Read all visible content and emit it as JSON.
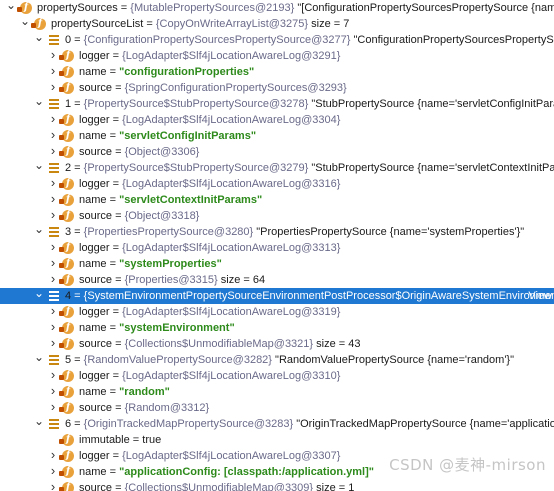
{
  "rows": [
    {
      "indent": 0,
      "toggle": "down",
      "icon": "field",
      "name": "propertySources",
      "eq": " = ",
      "val": "{MutablePropertySources@2193}",
      "extra": " \"[ConfigurationPropertySourcesPropertySource {name='c..."
    },
    {
      "indent": 1,
      "toggle": "down",
      "icon": "field",
      "name": "propertySourceList",
      "eq": " = ",
      "val": "{CopyOnWriteArrayList@3275}",
      "extra": "  size = 7"
    },
    {
      "indent": 2,
      "toggle": "down",
      "icon": "list",
      "name": "0",
      "eq": " = ",
      "val": "{ConfigurationPropertySourcesPropertySource@3277}",
      "extra": " \"ConfigurationPropertySourcesPropertySource {nam"
    },
    {
      "indent": 3,
      "toggle": "right",
      "icon": "field",
      "name": "logger",
      "eq": " = ",
      "val": "{LogAdapter$Slf4jLocationAwareLog@3291}",
      "extra": ""
    },
    {
      "indent": 3,
      "toggle": "right",
      "icon": "field",
      "name": "name",
      "eq": " = ",
      "str": "\"configurationProperties\"",
      "extra": ""
    },
    {
      "indent": 3,
      "toggle": "right",
      "icon": "field",
      "name": "source",
      "eq": " = ",
      "val": "{SpringConfigurationPropertySources@3293}",
      "extra": ""
    },
    {
      "indent": 2,
      "toggle": "down",
      "icon": "list",
      "name": "1",
      "eq": " = ",
      "val": "{PropertySource$StubPropertySource@3278}",
      "extra": " \"StubPropertySource {name='servletConfigInitParams'}\""
    },
    {
      "indent": 3,
      "toggle": "right",
      "icon": "field",
      "name": "logger",
      "eq": " = ",
      "val": "{LogAdapter$Slf4jLocationAwareLog@3304}",
      "extra": ""
    },
    {
      "indent": 3,
      "toggle": "right",
      "icon": "field",
      "name": "name",
      "eq": " = ",
      "str": "\"servletConfigInitParams\"",
      "extra": ""
    },
    {
      "indent": 3,
      "toggle": "right",
      "icon": "field",
      "name": "source",
      "eq": " = ",
      "val": "{Object@3306}",
      "extra": ""
    },
    {
      "indent": 2,
      "toggle": "down",
      "icon": "list",
      "name": "2",
      "eq": " = ",
      "val": "{PropertySource$StubPropertySource@3279}",
      "extra": " \"StubPropertySource {name='servletContextInitParams'}\""
    },
    {
      "indent": 3,
      "toggle": "right",
      "icon": "field",
      "name": "logger",
      "eq": " = ",
      "val": "{LogAdapter$Slf4jLocationAwareLog@3316}",
      "extra": ""
    },
    {
      "indent": 3,
      "toggle": "right",
      "icon": "field",
      "name": "name",
      "eq": " = ",
      "str": "\"servletContextInitParams\"",
      "extra": ""
    },
    {
      "indent": 3,
      "toggle": "right",
      "icon": "field",
      "name": "source",
      "eq": " = ",
      "val": "{Object@3318}",
      "extra": ""
    },
    {
      "indent": 2,
      "toggle": "down",
      "icon": "list",
      "name": "3",
      "eq": " = ",
      "val": "{PropertiesPropertySource@3280}",
      "extra": " \"PropertiesPropertySource {name='systemProperties'}\""
    },
    {
      "indent": 3,
      "toggle": "right",
      "icon": "field",
      "name": "logger",
      "eq": " = ",
      "val": "{LogAdapter$Slf4jLocationAwareLog@3313}",
      "extra": ""
    },
    {
      "indent": 3,
      "toggle": "right",
      "icon": "field",
      "name": "name",
      "eq": " = ",
      "str": "\"systemProperties\"",
      "extra": ""
    },
    {
      "indent": 3,
      "toggle": "right",
      "icon": "field",
      "name": "source",
      "eq": " = ",
      "val": "{Properties@3315}",
      "extra": "  size = 64"
    },
    {
      "indent": 2,
      "toggle": "down",
      "icon": "list",
      "name": "4",
      "eq": " = ",
      "val": "{SystemEnvironmentPropertySourceEnvironmentPostProcessor$OriginAwareSystemEnvironmentProp...",
      "extra": "",
      "selected": true,
      "link": "View"
    },
    {
      "indent": 3,
      "toggle": "right",
      "icon": "field",
      "name": "logger",
      "eq": " = ",
      "val": "{LogAdapter$Slf4jLocationAwareLog@3319}",
      "extra": ""
    },
    {
      "indent": 3,
      "toggle": "right",
      "icon": "field",
      "name": "name",
      "eq": " = ",
      "str": "\"systemEnvironment\"",
      "extra": ""
    },
    {
      "indent": 3,
      "toggle": "right",
      "icon": "field",
      "name": "source",
      "eq": " = ",
      "val": "{Collections$UnmodifiableMap@3321}",
      "extra": "  size = 43"
    },
    {
      "indent": 2,
      "toggle": "down",
      "icon": "list",
      "name": "5",
      "eq": " = ",
      "val": "{RandomValuePropertySource@3282}",
      "extra": " \"RandomValuePropertySource {name='random'}\""
    },
    {
      "indent": 3,
      "toggle": "right",
      "icon": "field",
      "name": "logger",
      "eq": " = ",
      "val": "{LogAdapter$Slf4jLocationAwareLog@3310}",
      "extra": ""
    },
    {
      "indent": 3,
      "toggle": "right",
      "icon": "field",
      "name": "name",
      "eq": " = ",
      "str": "\"random\"",
      "extra": ""
    },
    {
      "indent": 3,
      "toggle": "right",
      "icon": "field",
      "name": "source",
      "eq": " = ",
      "val": "{Random@3312}",
      "extra": ""
    },
    {
      "indent": 2,
      "toggle": "down",
      "icon": "list",
      "name": "6",
      "eq": " = ",
      "val": "{OriginTrackedMapPropertySource@3283}",
      "extra": " \"OriginTrackedMapPropertySource {name='applicationConfig:"
    },
    {
      "indent": 3,
      "toggle": "none",
      "icon": "field",
      "name": "immutable",
      "eq": " = ",
      "plain": "true",
      "extra": ""
    },
    {
      "indent": 3,
      "toggle": "right",
      "icon": "field",
      "name": "logger",
      "eq": " = ",
      "val": "{LogAdapter$Slf4jLocationAwareLog@3307}",
      "extra": ""
    },
    {
      "indent": 3,
      "toggle": "right",
      "icon": "field",
      "name": "name",
      "eq": " = ",
      "str": "\"applicationConfig: [classpath:/application.yml]\"",
      "extra": ""
    },
    {
      "indent": 3,
      "toggle": "right",
      "icon": "field",
      "name": "source",
      "eq": " = ",
      "val": "{Collections$UnmodifiableMap@3309}",
      "extra": "  size = 1"
    }
  ],
  "watermark": "CSDN @麦神-mirson",
  "colors": {
    "selected_bg": "#1f78d1",
    "string": "#2d8a1b",
    "value": "#6a6a8a"
  }
}
